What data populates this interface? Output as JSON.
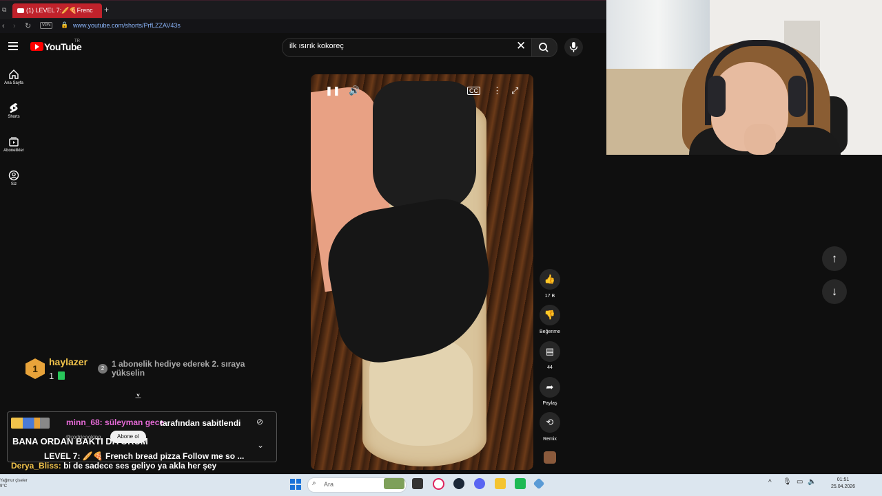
{
  "browser": {
    "tab_title": "(1) LEVEL 7:🥖🍕Frenc",
    "vpn_label": "VPN",
    "url": "www.youtube.com/shorts/PrfLZZAV43s"
  },
  "youtube": {
    "logo_text": "YouTube",
    "country_code": "TR",
    "search_query": "ilk ısırık kokoreç",
    "sidebar": [
      {
        "label": "Ana Sayfa",
        "icon": "home-icon"
      },
      {
        "label": "Shorts",
        "icon": "shorts-icon"
      },
      {
        "label": "Abonelikler",
        "icon": "subscriptions-icon"
      },
      {
        "label": "Siz",
        "icon": "you-icon"
      }
    ],
    "actions": {
      "like_count": "17 B",
      "dislike_label": "Beğenme",
      "comment_count": "44",
      "share_label": "Paylaş",
      "remix_label": "Remix"
    }
  },
  "chat_overlay": {
    "top_rank": "1",
    "top_user": "haylazer",
    "top_user_count": "1",
    "rank2": "2",
    "upsell_text": "1 abonelik hediye ederek 2. sıraya yükselin",
    "pinned_user": "minn_68: süleyman gece",
    "pinned_suffix": "tarafından sabitlendi",
    "pinned_message": "BANA ORDAN BAKTI DİYORUM",
    "channel_handle": "@rodricooking",
    "subscribe_label": "Abone ol",
    "video_caption": "LEVEL 7: 🥖🍕 French bread pizza Follow me so ...",
    "chat_user": "Derya_Bliss:",
    "chat_message": "bi de sadece ses geliyo ya akla her şey"
  },
  "taskbar": {
    "weather_line1": "Yağmur çiseler",
    "weather_line2": "9°C",
    "search_placeholder": "Ara",
    "time": "01:51",
    "date": "25.04.2026"
  },
  "colors": {
    "tab_red": "#c0222b",
    "youtube_red": "#ff0000",
    "username_gold": "#f1c34b",
    "pinned_pink": "#e56ad6"
  }
}
